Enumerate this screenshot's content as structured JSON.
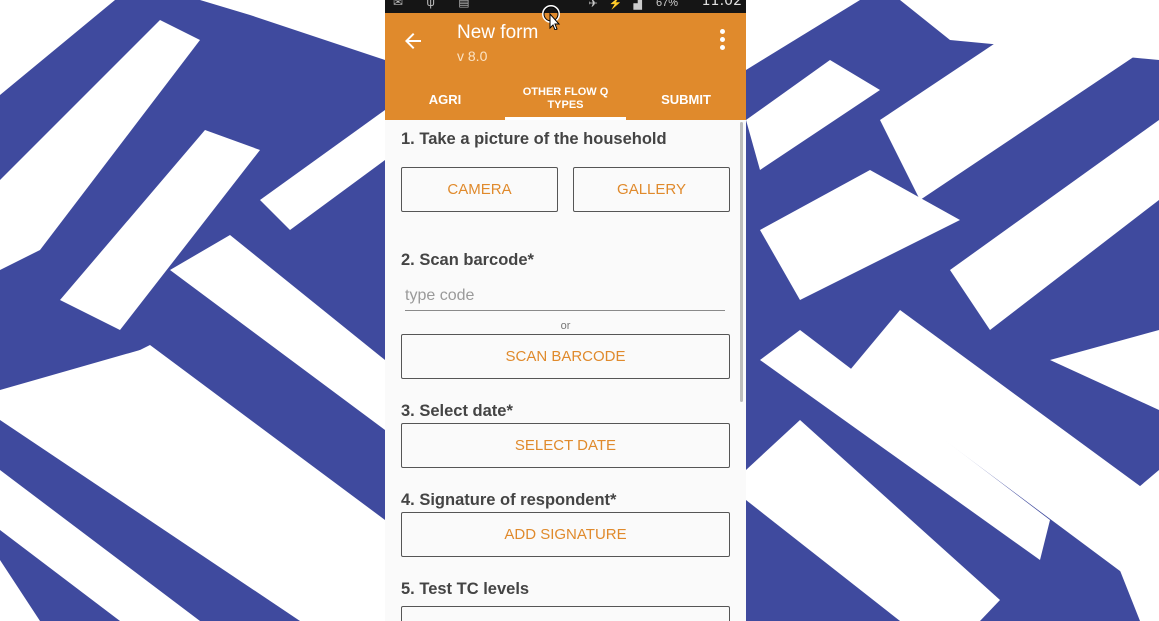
{
  "toolbar": {
    "title": "New form",
    "version": "v 8.0",
    "back_icon": "arrow-left-icon",
    "menu_icon": "overflow-menu-icon"
  },
  "status_bar": {
    "battery": "67%",
    "time": "11:02"
  },
  "tabs": [
    {
      "label": "AGRI"
    },
    {
      "label": "OTHER FLOW Q TYPES",
      "active": true
    },
    {
      "label": "SUBMIT"
    }
  ],
  "questions": {
    "q1": {
      "label": "1. Take a picture of the household",
      "camera": "CAMERA",
      "gallery": "GALLERY"
    },
    "q2": {
      "label": "2. Scan barcode*",
      "placeholder": "type code",
      "or": "or",
      "scan": "SCAN BARCODE"
    },
    "q3": {
      "label": "3. Select date*",
      "button": "SELECT DATE"
    },
    "q4": {
      "label": "4. Signature of respondent*",
      "button": "ADD SIGNATURE"
    },
    "q5": {
      "label": "5. Test TC levels"
    }
  },
  "colors": {
    "accent": "#e08a2c",
    "background": "#3f4a9e",
    "wallpaper_stroke": "#ffffff"
  }
}
